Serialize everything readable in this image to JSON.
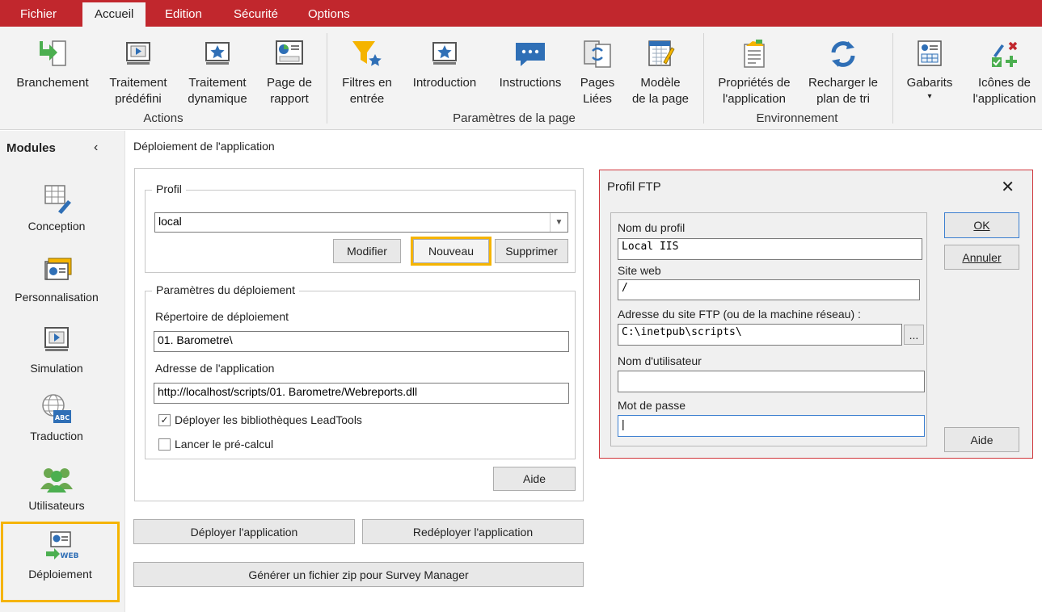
{
  "tabs": [
    {
      "label": "Fichier",
      "active": false
    },
    {
      "label": "Accueil",
      "active": true
    },
    {
      "label": "Edition",
      "active": false
    },
    {
      "label": "Sécurité",
      "active": false
    },
    {
      "label": "Options",
      "active": false
    }
  ],
  "ribbon": {
    "actions_group": "Actions",
    "page_group": "Paramètres de la page",
    "env_group": "Environnement",
    "buttons": {
      "branchement": "Branchement",
      "traitement_predefini": "Traitement\nprédéfini",
      "traitement_dynamique": "Traitement\ndynamique",
      "page_rapport": "Page de\nrapport",
      "filtres": "Filtres en\nentrée",
      "introduction": "Introduction",
      "instructions": "Instructions",
      "pages_liees": "Pages\nLiées",
      "modele_page": "Modèle\nde la page",
      "proprietes": "Propriétés de\nl'application",
      "recharger": "Recharger le\nplan de tri",
      "gabarits": "Gabarits",
      "icones": "Icônes de\nl'application"
    },
    "gabarits_caret": "▾"
  },
  "sidebar": {
    "title": "Modules",
    "collapse": "‹",
    "items": [
      {
        "label": "Conception",
        "icon": "grid-pencil-icon"
      },
      {
        "label": "Personnalisation",
        "icon": "cards-icon"
      },
      {
        "label": "Simulation",
        "icon": "monitor-play-icon"
      },
      {
        "label": "Traduction",
        "icon": "globe-abc-icon"
      },
      {
        "label": "Utilisateurs",
        "icon": "users-icon"
      },
      {
        "label": "Déploiement",
        "icon": "web-deploy-icon",
        "active": true
      }
    ]
  },
  "main": {
    "title": "Déploiement de l'application",
    "profil": {
      "legend": "Profil",
      "selected": "local",
      "modifier": "Modifier",
      "nouveau": "Nouveau",
      "supprimer": "Supprimer"
    },
    "params": {
      "legend": "Paramètres du déploiement",
      "repertoire_label": "Répertoire de déploiement",
      "repertoire_value": "01. Barometre\\",
      "adresse_label": "Adresse de l'application",
      "adresse_value": "http://localhost/scripts/01. Barometre/Webreports.dll",
      "leadtools_label": "Déployer les bibliothèques LeadTools",
      "leadtools_checked": true,
      "leadtools_mark": "✓",
      "precalc_label": "Lancer le pré-calcul",
      "precalc_checked": false
    },
    "aide": "Aide",
    "deployer": "Déployer l'application",
    "redeployer": "Redéployer l'application",
    "zip": "Générer un fichier zip pour Survey Manager"
  },
  "dialog": {
    "title": "Profil FTP",
    "close": "✕",
    "nom_label": "Nom du profil",
    "nom_value": "Local IIS",
    "site_label": "Site web",
    "site_value": "/",
    "ftp_label": "Adresse du site FTP (ou de la machine réseau) :",
    "ftp_value": "C:\\inetpub\\scripts\\",
    "browse": "...",
    "user_label": "Nom d'utilisateur",
    "user_value": "",
    "pass_label": "Mot de passe",
    "pass_value": "|",
    "ok": "OK",
    "annuler": "Annuler",
    "aide": "Aide"
  },
  "colors": {
    "accent": "#c1272d",
    "highlight": "#f5b400",
    "dialog_border": "#d0353b"
  }
}
